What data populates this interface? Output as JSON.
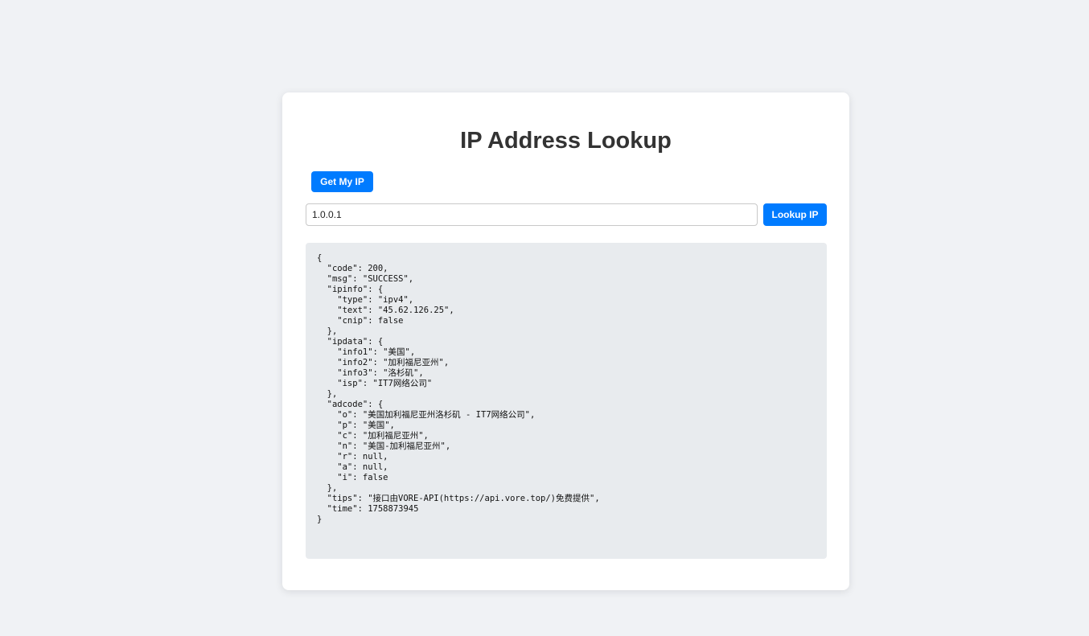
{
  "header": {
    "title": "IP Address Lookup"
  },
  "controls": {
    "get_my_ip_label": "Get My IP",
    "ip_input_value": "1.0.0.1",
    "lookup_label": "Lookup IP"
  },
  "result": {
    "text": "{\n  \"code\": 200,\n  \"msg\": \"SUCCESS\",\n  \"ipinfo\": {\n    \"type\": \"ipv4\",\n    \"text\": \"45.62.126.25\",\n    \"cnip\": false\n  },\n  \"ipdata\": {\n    \"info1\": \"美国\",\n    \"info2\": \"加利福尼亚州\",\n    \"info3\": \"洛杉矶\",\n    \"isp\": \"IT7网络公司\"\n  },\n  \"adcode\": {\n    \"o\": \"美国加利福尼亚州洛杉矶 - IT7网络公司\",\n    \"p\": \"美国\",\n    \"c\": \"加利福尼亚州\",\n    \"n\": \"美国-加利福尼亚州\",\n    \"r\": null,\n    \"a\": null,\n    \"i\": false\n  },\n  \"tips\": \"接口由VORE-API(https://api.vore.top/)免费提供\",\n  \"time\": 1758873945\n}"
  },
  "colors": {
    "page_background": "#f0f2f5",
    "card_background": "#ffffff",
    "accent": "#007bff",
    "result_background": "#e8ebee",
    "title_text": "#333333"
  }
}
